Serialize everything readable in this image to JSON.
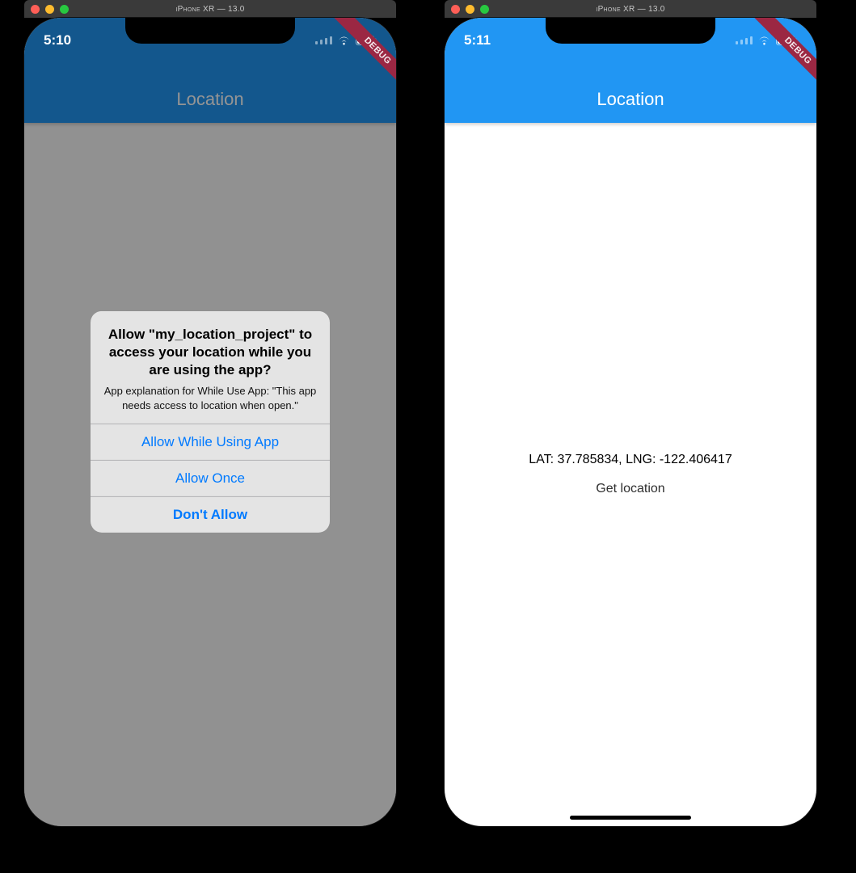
{
  "simulator": {
    "title": "iPhone XR — 13.0"
  },
  "left": {
    "status_time": "5:10",
    "debug_banner": "DEBUG",
    "app_bar_title": "Location",
    "alert": {
      "title": "Allow \"my_location_project\" to access your location while you are using the app?",
      "message": "App explanation for While Use App: \"This app needs access to location when open.\"",
      "buttons": {
        "allow_while": "Allow While Using App",
        "allow_once": "Allow Once",
        "dont_allow": "Don't Allow"
      }
    }
  },
  "right": {
    "status_time": "5:11",
    "debug_banner": "DEBUG",
    "app_bar_title": "Location",
    "coords_text": "LAT: 37.785834, LNG: -122.406417",
    "get_location_label": "Get location"
  },
  "colors": {
    "accent": "#2196f3",
    "ios_blue": "#007aff"
  }
}
